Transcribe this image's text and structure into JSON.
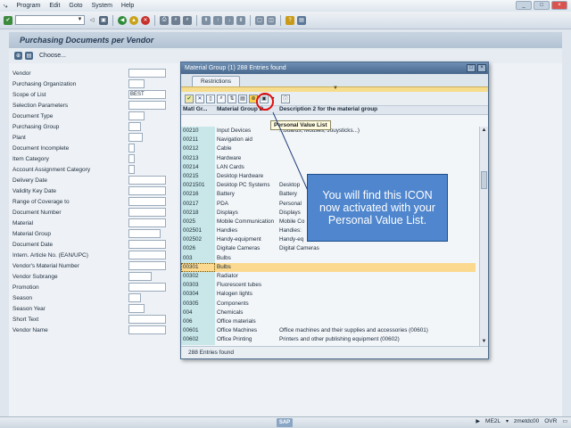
{
  "menubar": {
    "items": [
      "Program",
      "Edit",
      "Goto",
      "System",
      "Help"
    ]
  },
  "page": {
    "title": "Purchasing Documents per Vendor",
    "choose_label": "Choose..."
  },
  "selection": {
    "labels": [
      "Vendor",
      "Purchasing Organization",
      "Scope of List",
      "Selection Parameters",
      "Document Type",
      "Purchasing Group",
      "Plant",
      "Document Incomplete",
      "Item Category",
      "Account Assignment Category",
      "Delivery Date",
      "Validity Key Date",
      "Range of Coverage to",
      "Document Number",
      "Material",
      "Material Group",
      "Document Date",
      "Intern. Article No. (EAN/UPC)",
      "Vendor's Material Number",
      "Vendor Subrange",
      "Promotion",
      "Season",
      "Season Year",
      "Short Text",
      "Vendor Name"
    ],
    "scope_of_list_value": "BEST"
  },
  "popup": {
    "title": "Material Group (1)  288 Entries found",
    "tab_label": "Restrictions",
    "columns": [
      "Matl Gr...",
      "Material Group D...",
      "Description 2 for the material group"
    ],
    "rows": [
      [
        "00210",
        "Input Devices",
        "...boards, Mouses, Jouysticks...)"
      ],
      [
        "00211",
        "Navigation aid",
        ""
      ],
      [
        "00212",
        "Cable",
        ""
      ],
      [
        "00213",
        "Hardware",
        ""
      ],
      [
        "00214",
        "LAN Cards",
        ""
      ],
      [
        "00215",
        "Desktop Hardware",
        ""
      ],
      [
        "0021501",
        "Desktop PC Systems",
        "Desktop"
      ],
      [
        "00216",
        "Battery",
        "Battery"
      ],
      [
        "00217",
        "PDA",
        "Personal"
      ],
      [
        "00218",
        "Displays",
        "Displays"
      ],
      [
        "0025",
        "Mobile Communication",
        "Mobile Co"
      ],
      [
        "002501",
        "Handies",
        "Handies:"
      ],
      [
        "002502",
        "Handy-equipment",
        "Handy-eq"
      ],
      [
        "0026",
        "Digitale Cameras",
        "Digital Cameras"
      ],
      [
        "003",
        "Bulbs",
        ""
      ],
      [
        "00301",
        "Bulbs",
        ""
      ],
      [
        "00302",
        "Radiator",
        ""
      ],
      [
        "00303",
        "Fluorescent tubes",
        ""
      ],
      [
        "00304",
        "Halogen lights",
        ""
      ],
      [
        "00305",
        "Components",
        ""
      ],
      [
        "004",
        "Chemicals",
        ""
      ],
      [
        "006",
        "Office materials",
        ""
      ],
      [
        "00601",
        "Office Machines",
        "Office machines and their supplies and accessories (00601)"
      ],
      [
        "00602",
        "Office Printing",
        "Printers and other publishing equipment (00602)"
      ]
    ],
    "footer": "288 Entries found"
  },
  "tooltip": "Personal Value List",
  "callout": "You will find this ICON now activated with your Personal Value List.",
  "statusbar": {
    "logo": "SAP",
    "tcode": "ME2L",
    "server": "zmetdc00",
    "mode": "OVR"
  },
  "colors": {
    "callout_bg": "#4f86cd",
    "highlight_ring": "#e01010",
    "selected_row": "#fbd98f",
    "key_column": "#c9e7e8"
  }
}
